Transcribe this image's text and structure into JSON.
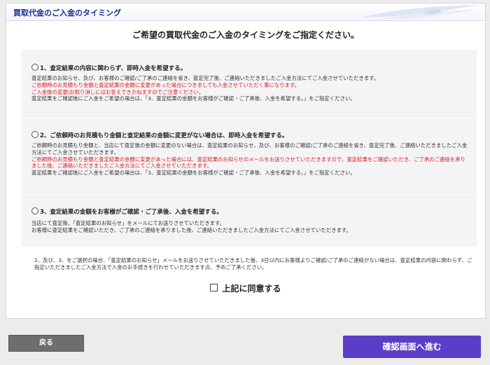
{
  "panel": {
    "title": "買取代金のご入金のタイミング"
  },
  "heading": "ご希望の買取代金のご入金のタイミングをご指定ください。",
  "options": [
    {
      "label": "1、査定結果の内容に関わらず、即時入金を希望する。",
      "lines": [
        {
          "text": "査定結果のお知らせ、及び、お客様のご確認/ご了承のご連絡を省き、査定完了後、ご連絡いただきましたご入金方法にてご入金させていただきます。",
          "red": false
        },
        {
          "text": "ご依頼時のお見積もり金額と査定結果の金額に変更があった場合につきましても入金させていただく事になります。",
          "red": true
        },
        {
          "text": "ご入金後の変更/お取り消しにはお答えできかねますのでご注意ください。",
          "red": true
        },
        {
          "text": "査定結果をご確認後にご入金をご希望の場合は、「3、査定結果の金額をお客様がご確認・ご了承後、入金を希望する。」をご指定ください。",
          "red": false
        }
      ]
    },
    {
      "label": "2、ご依頼時のお見積もり金額と査定結果の金額に変更がない場合は、即時入金を希望する。",
      "lines": [
        {
          "text": "ご依頼時のお見積もり金額と、当店にて査定後の金額に変更のない場合は、査定結果のお知らせ、及び、お客様のご確認/ご了承のご連絡を省き、査定完了後、ご連絡いただきましたご入金方法にてご入金させていただきます。",
          "red": false
        },
        {
          "text": "ご依頼時のお見積もり金額と査定結果の金額に変更があった場合には、査定結果のお知らせのメールをお送りさせていただきますので、査定結果をご確認いただき、ご了承のご連絡を承りました後、ご連絡いただきましたご入金方法にてご入金させていただきます。",
          "red": true
        },
        {
          "text": "査定結果をご確認後にご入金をご希望の場合は、「3、査定結果の金額をお客様がご確認・ご了承後、入金を希望する。」をご指定ください。",
          "red": false
        }
      ]
    },
    {
      "label": "3、査定結果の金額をお客様がご確認・ご了承後、入金を希望する。",
      "lines": [
        {
          "text": "当店にて査定後、「査定結果のお知らせ」をメールにてお送りさせていただきます。",
          "red": false
        },
        {
          "text": "お客様に査定結果をご確認いただき、ご了承のご連絡を承りました後、ご連絡いただきましたご入金方法にてご入金させていただきます。",
          "red": false
        }
      ]
    }
  ],
  "note": "2、及び、3、をご選択の場合、「査定結果のお知らせ」メールをお送りさせていただきました後、3日以内にお客様よりご確認/ご了承のご連絡がない場合は、査定結果の内容に関わらず、ご指定いただきましたご入金方法で入金のお手続きを行わせていただきます点、予めご了承ください。",
  "agree_label": "上記に同意する",
  "buttons": {
    "back": "戻る",
    "next": "確認画面へ進む"
  },
  "colors": {
    "title": "#1a2f93",
    "warning": "#e01a1a",
    "next_button": "#5b3ec8",
    "back_button": "#6e6e6e"
  }
}
